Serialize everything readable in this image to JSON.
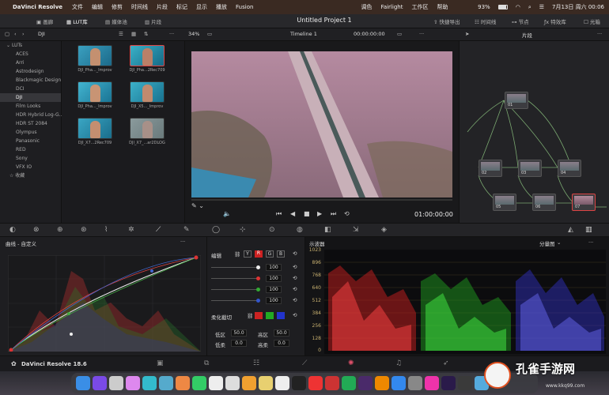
{
  "menubar": {
    "app_name": "DaVinci Resolve",
    "items": [
      "文件",
      "编辑",
      "修剪",
      "时间线",
      "片段",
      "标记",
      "显示",
      "播放",
      "Fusion"
    ],
    "right": [
      "调色",
      "Fairlight",
      "工作区",
      "帮助"
    ],
    "battery": "93%",
    "clock": "7月13日 周六 00:06"
  },
  "toolbar": {
    "gallery": "画廊",
    "lut_lib": "LUT库",
    "media_pool": "媒体池",
    "clips": "片段",
    "project_title": "Untitled Project 1",
    "quick_export": "快捷导出",
    "timeline": "时间线",
    "nodes": "节点",
    "effects": "特效库",
    "lightbox": "光箱"
  },
  "toolbar2": {
    "folder": "DJI",
    "zoom": "34%",
    "timeline_name": "Timeline 1",
    "timecode": "00:00:00:00",
    "clip_label": "片段"
  },
  "lut_list": {
    "root": "LUTs",
    "items": [
      "ACES",
      "Arri",
      "Astrodesign",
      "Blackmagic Design",
      "DCI",
      "DJI",
      "Film Looks",
      "HDR Hybrid Log-G...",
      "HDR ST 2084",
      "Olympus",
      "Panasonic",
      "RED",
      "Sony",
      "VFX IO"
    ],
    "selected": "DJI",
    "favorites": "收藏"
  },
  "thumbnails": [
    {
      "label": "DJI_Pha..._Improv"
    },
    {
      "label": "DJI_Pha...2Rec709"
    },
    {
      "label": "DJI_Pha..._Improv"
    },
    {
      "label": "DJI_X5..._Improv"
    },
    {
      "label": "DJI_X7...2Rec709"
    },
    {
      "label": "DJI_X7_...ar2DLOG"
    }
  ],
  "viewer": {
    "timecode": "01:00:00:00"
  },
  "nodes": {
    "labels": [
      "01",
      "02",
      "03",
      "04",
      "05",
      "06",
      "07"
    ]
  },
  "curves": {
    "title": "曲线 - 自定义"
  },
  "edit_panel": {
    "title": "编辑",
    "channels": [
      "Y",
      "R",
      "G",
      "B"
    ],
    "values": [
      "100",
      "100",
      "100",
      "100"
    ],
    "soft_clip": "柔化截切",
    "low": "低区",
    "high": "高区",
    "low_soft": "低柔",
    "high_soft": "高柔",
    "low_val": "50.0",
    "high_val": "50.0",
    "low_soft_val": "0.0",
    "high_soft_val": "0.0"
  },
  "scope": {
    "title": "示波器",
    "mode": "分量图",
    "ticks": [
      "1023",
      "896",
      "768",
      "640",
      "512",
      "384",
      "256",
      "128",
      "0"
    ]
  },
  "status": {
    "app": "DaVinci Resolve 18.6"
  },
  "watermark": {
    "text": "孔雀手游网",
    "url": "www.kkq99.com"
  }
}
